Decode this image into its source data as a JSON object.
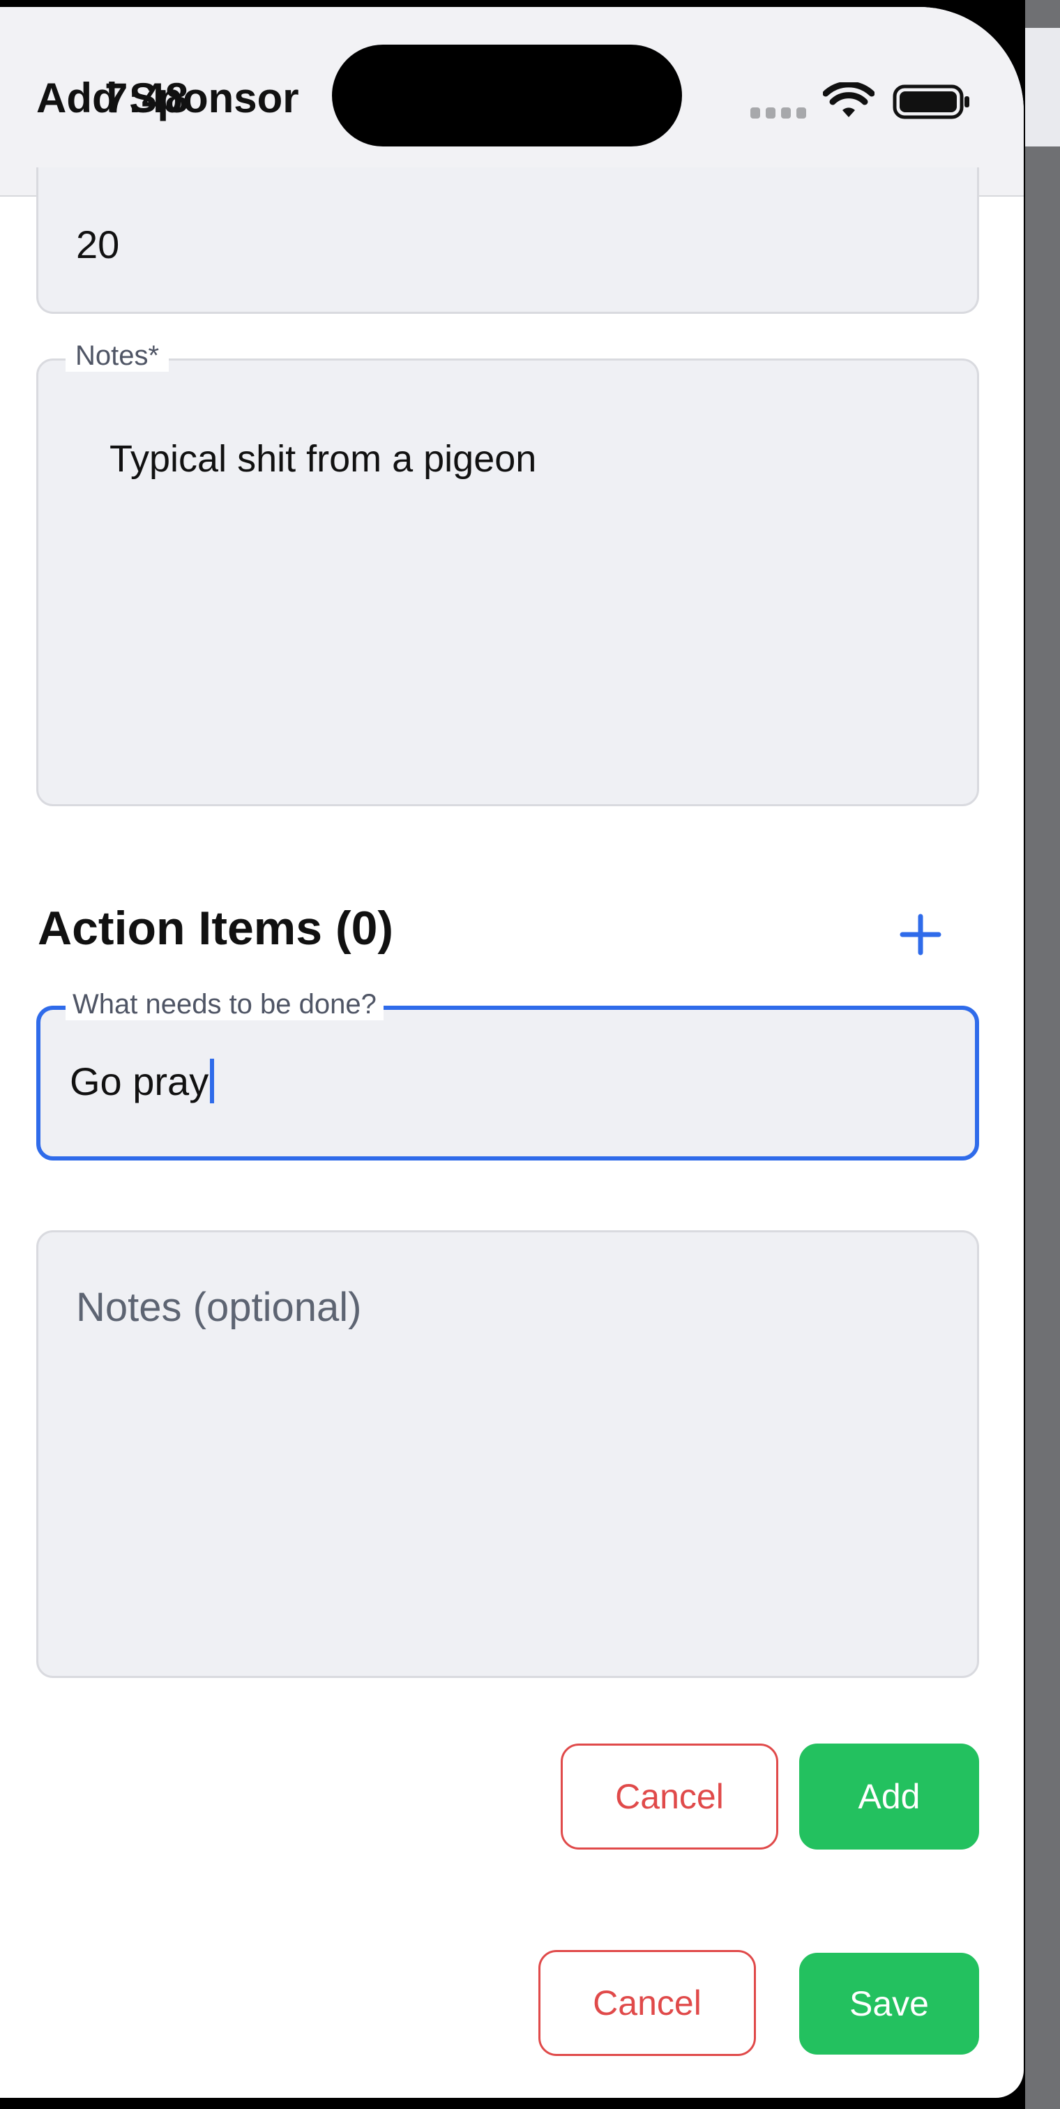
{
  "status_bar": {
    "time": "7:48",
    "wifi_icon": "wifi-icon",
    "battery_icon": "battery-icon"
  },
  "header": {
    "title": "Add Sponsor"
  },
  "form": {
    "number_field": {
      "value": "20"
    },
    "notes_field": {
      "label": "Notes*",
      "value": "Typical shit from a pigeon"
    }
  },
  "action_items": {
    "title": "Action Items (0)",
    "add_icon": "plus-icon",
    "task_field": {
      "label": "What needs to be done?",
      "value": "Go pray"
    },
    "notes_field": {
      "placeholder": "Notes (optional)"
    },
    "cancel_label": "Cancel",
    "add_label": "Add"
  },
  "footer": {
    "cancel_label": "Cancel",
    "save_label": "Save"
  },
  "colors": {
    "accent_blue": "#2f6bea",
    "success_green": "#23c15f",
    "danger_red": "#e04a4a"
  }
}
